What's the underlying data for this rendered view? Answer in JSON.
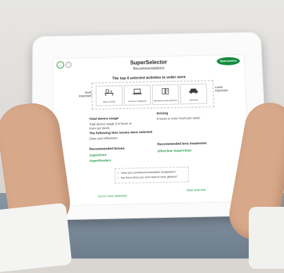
{
  "app": {
    "title": "SuperSelector",
    "subtitle": "Recommendations",
    "brand": "Specsavers"
  },
  "activities": {
    "heading": "The top 4 selected activites in order were",
    "most_label": "Most important",
    "least_label": "Least important",
    "items": [
      {
        "label": "DESK WORK",
        "icon": "desk-work-icon"
      },
      {
        "label": "DIGITAL SCREENS",
        "icon": "laptop-icon"
      },
      {
        "label": "READING AND WRITING",
        "icon": "book-icon"
      },
      {
        "label": "DRIVING",
        "icon": "car-icon"
      }
    ]
  },
  "usage": {
    "total_title": "Total device usage",
    "total_text": "Total device usage is 8 hours or more per week.",
    "driving_title": "Driving",
    "driving_text": "8 hours or more hours per week.",
    "issues_title": "The following lens issues were selected",
    "issues_text": "Glare and reflections"
  },
  "recommendations": {
    "lenses_title": "Recommended lenses",
    "lenses": [
      "SuperDrive",
      "SuperReaders"
    ],
    "treatments_title": "Recommended lens treatments",
    "treatments": [
      "UltraClear SuperClean"
    ]
  },
  "notes": [
    "Have you considered prescription sunglasses?",
    "Are there times you don't want to wear glasses?"
  ],
  "footer": {
    "left_link": "Go to Lens selection",
    "right_link": "Start new test"
  },
  "colors": {
    "accent": "#1e9b48",
    "brand": "#0f8c3c"
  }
}
